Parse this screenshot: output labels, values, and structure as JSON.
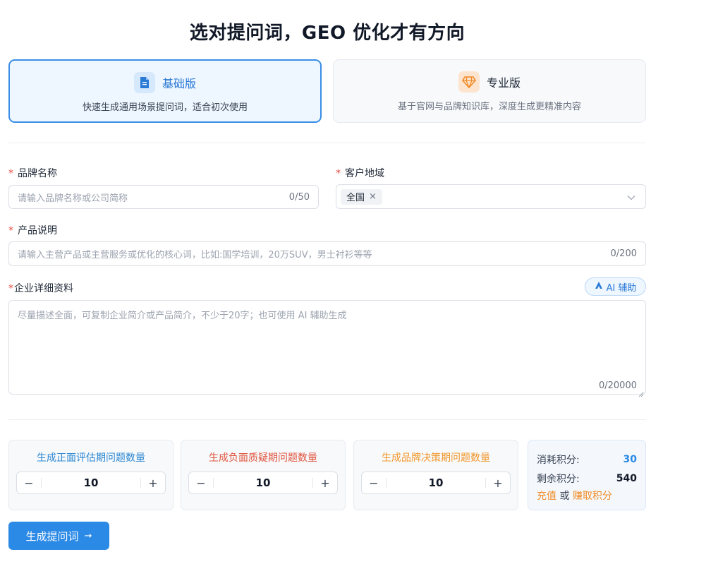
{
  "title": "选对提问词，GEO 优化才有方向",
  "versions": [
    {
      "name": "基础版",
      "desc": "快速生成通用场景提问词，适合初次使用",
      "icon": "document-icon"
    },
    {
      "name": "专业版",
      "desc": "基于官网与品牌知识库，深度生成更精准内容",
      "icon": "diamond-icon"
    }
  ],
  "brand": {
    "required_mark": "*",
    "label": "品牌名称",
    "placeholder": "请输入品牌名称或公司简称",
    "counter": "0/50"
  },
  "region": {
    "required_mark": "*",
    "label": "客户地域",
    "selected_tag": "全国",
    "remove_glyph": "×",
    "chevron_icon": "chevron-down-icon"
  },
  "product": {
    "required_mark": "*",
    "label": "产品说明",
    "placeholder": "请输入主营产品或主营服务或优化的核心词，比如:国学培训，20万SUV，男士衬衫等等",
    "counter": "0/200"
  },
  "company": {
    "required_mark": "*",
    "label": "企业详细资料",
    "placeholder": "尽量描述全面，可复制企业简介或产品简介，不少于20字；也可使用 AI 辅助生成",
    "counter": "0/20000",
    "ai_button": "AI 辅助"
  },
  "question_counts": [
    {
      "title": "生成正面评估期问题数量",
      "value": "10",
      "color": "#2a86d1"
    },
    {
      "title": "生成负面质疑期问题数量",
      "value": "10",
      "color": "#e0543d"
    },
    {
      "title": "生成品牌决策期问题数量",
      "value": "10",
      "color": "#f0962a"
    }
  ],
  "stepper": {
    "minus": "−",
    "plus": "+"
  },
  "points": {
    "cost_label": "消耗积分:",
    "cost_value": "30",
    "cost_color": "#2b8ae6",
    "remain_label": "剩余积分:",
    "remain_value": "540",
    "recharge": "充值",
    "or": "或",
    "earn": "赚取积分"
  },
  "generate_button": {
    "label": "生成提问词",
    "arrow": "→"
  }
}
